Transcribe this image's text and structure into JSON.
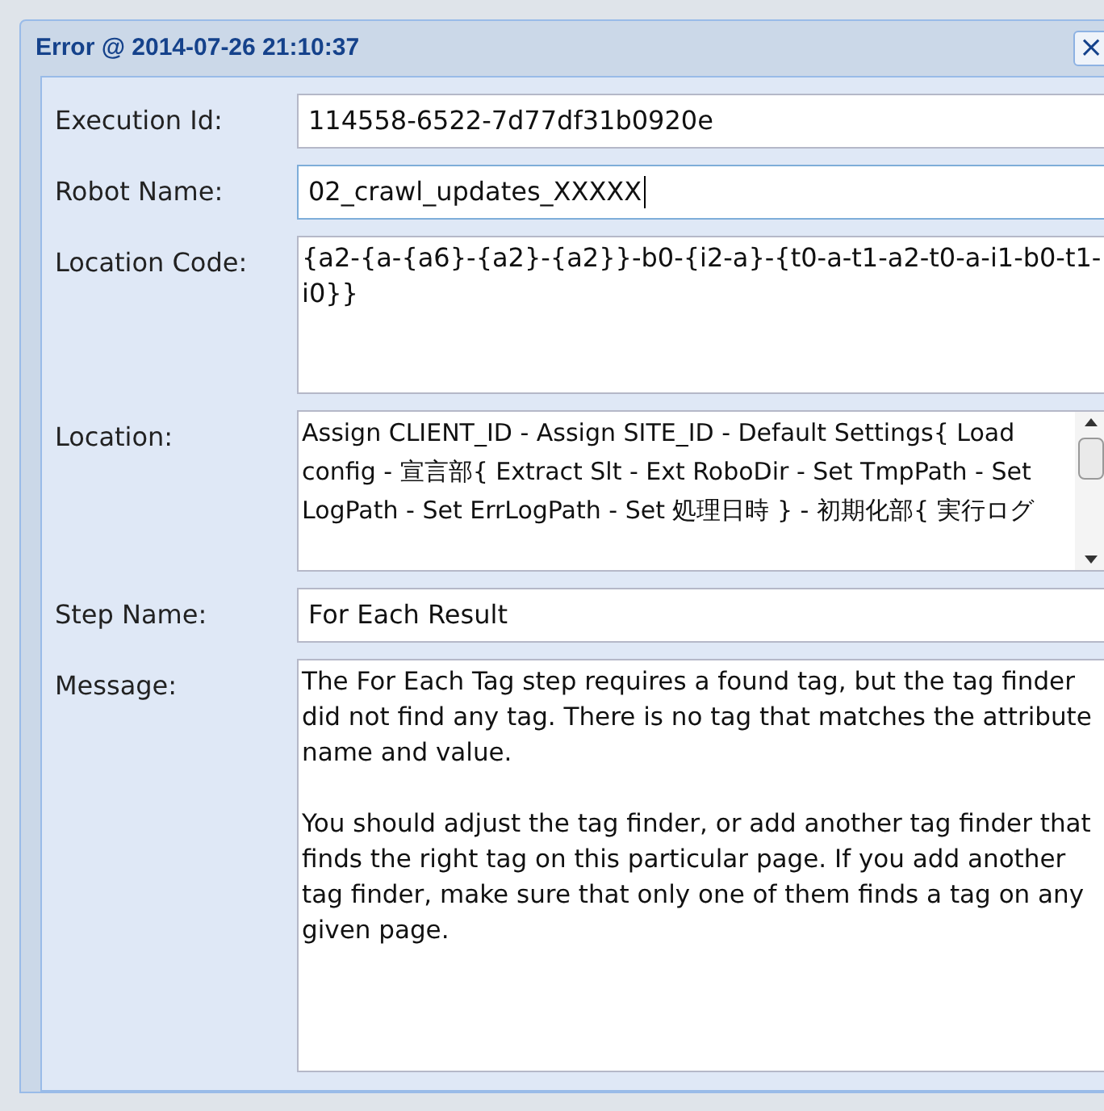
{
  "dialog": {
    "title": "Error @ 2014-07-26 21:10:37",
    "close": "×"
  },
  "fields": [
    {
      "kind": "line",
      "label": "Execution Id:",
      "value": "114558-6522-7d77df31b0920e",
      "focused": false
    },
    {
      "kind": "line",
      "label": "Robot Name:",
      "value": "02_crawl_updates_XXXXX",
      "focused": true
    },
    {
      "kind": "area",
      "label": "Location Code:",
      "value": "{a2-{a-{a6}-{a2}-{a2}}-b0-{i2-a}-{t0-a-t1-a2-t0-a-i1-b0-t1-i0}}"
    },
    {
      "kind": "scroll",
      "label": "Location:",
      "value": "Assign CLIENT_ID - Assign SITE_ID - Default Settings{ Load config - 宣言部{ Extract Slt - Ext RoboDir - Set TmpPath - Set LogPath - Set ErrLogPath - Set 処理日時 } - 初期化部{ 実行ログ"
    },
    {
      "kind": "line",
      "label": "Step Name:",
      "value": "For Each Result",
      "focused": false
    },
    {
      "kind": "message",
      "label": "Message:",
      "paragraphs": [
        "The For Each Tag step requires a found tag, but the tag finder did not find any tag. There is no tag that matches the attribute name and value.",
        "You should adjust the tag finder, or add another tag finder that finds the right tag on this particular page. If you add another tag finder, make sure that only one of them finds a tag on any given page."
      ]
    }
  ]
}
